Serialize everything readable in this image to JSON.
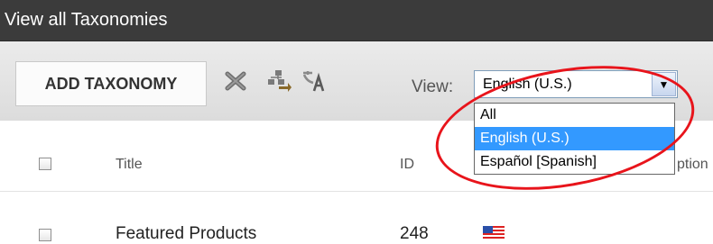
{
  "header": {
    "title": "View all Taxonomies"
  },
  "toolbar": {
    "add_label": "ADD TAXONOMY",
    "icons": [
      "delete-icon",
      "move-icon",
      "translate-icon"
    ],
    "view_label": "View:",
    "selected_language": "English (U.S.)"
  },
  "dropdown": {
    "options": [
      "All",
      "English (U.S.)",
      "Español [Spanish]"
    ],
    "selected_index": 1
  },
  "table": {
    "columns": {
      "title": "Title",
      "id": "ID",
      "description_partial": "ption"
    },
    "rows": [
      {
        "title": "Featured Products",
        "id": "248",
        "flag": "us-flag-icon"
      }
    ]
  },
  "annotation": {
    "color": "#e8141b"
  }
}
